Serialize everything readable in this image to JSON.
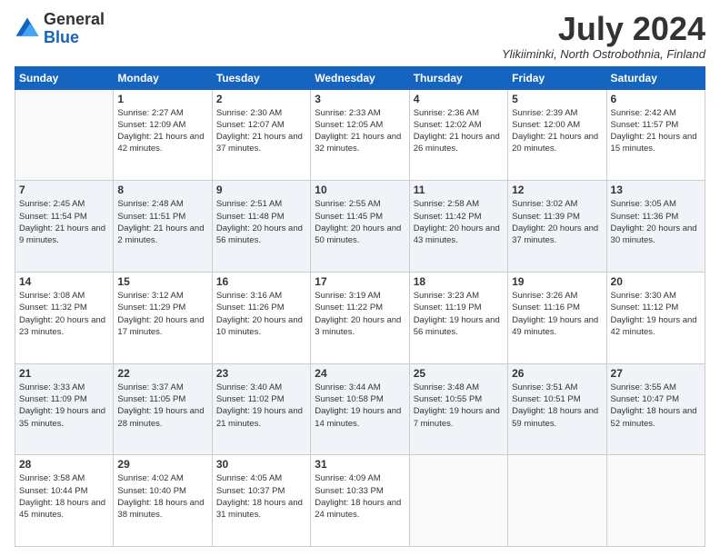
{
  "logo": {
    "general": "General",
    "blue": "Blue"
  },
  "title": "July 2024",
  "location": "Ylikiiminki, North Ostrobothnia, Finland",
  "days_of_week": [
    "Sunday",
    "Monday",
    "Tuesday",
    "Wednesday",
    "Thursday",
    "Friday",
    "Saturday"
  ],
  "weeks": [
    [
      {
        "day": "",
        "empty": true
      },
      {
        "day": "1",
        "sunrise": "Sunrise: 2:27 AM",
        "sunset": "Sunset: 12:09 AM",
        "daylight": "Daylight: 21 hours and 42 minutes."
      },
      {
        "day": "2",
        "sunrise": "Sunrise: 2:30 AM",
        "sunset": "Sunset: 12:07 AM",
        "daylight": "Daylight: 21 hours and 37 minutes."
      },
      {
        "day": "3",
        "sunrise": "Sunrise: 2:33 AM",
        "sunset": "Sunset: 12:05 AM",
        "daylight": "Daylight: 21 hours and 32 minutes."
      },
      {
        "day": "4",
        "sunrise": "Sunrise: 2:36 AM",
        "sunset": "Sunset: 12:02 AM",
        "daylight": "Daylight: 21 hours and 26 minutes."
      },
      {
        "day": "5",
        "sunrise": "Sunrise: 2:39 AM",
        "sunset": "Sunset: 12:00 AM",
        "daylight": "Daylight: 21 hours and 20 minutes."
      },
      {
        "day": "6",
        "sunrise": "Sunrise: 2:42 AM",
        "sunset": "Sunset: 11:57 PM",
        "daylight": "Daylight: 21 hours and 15 minutes."
      }
    ],
    [
      {
        "day": "7",
        "sunrise": "Sunrise: 2:45 AM",
        "sunset": "Sunset: 11:54 PM",
        "daylight": "Daylight: 21 hours and 9 minutes."
      },
      {
        "day": "8",
        "sunrise": "Sunrise: 2:48 AM",
        "sunset": "Sunset: 11:51 PM",
        "daylight": "Daylight: 21 hours and 2 minutes."
      },
      {
        "day": "9",
        "sunrise": "Sunrise: 2:51 AM",
        "sunset": "Sunset: 11:48 PM",
        "daylight": "Daylight: 20 hours and 56 minutes."
      },
      {
        "day": "10",
        "sunrise": "Sunrise: 2:55 AM",
        "sunset": "Sunset: 11:45 PM",
        "daylight": "Daylight: 20 hours and 50 minutes."
      },
      {
        "day": "11",
        "sunrise": "Sunrise: 2:58 AM",
        "sunset": "Sunset: 11:42 PM",
        "daylight": "Daylight: 20 hours and 43 minutes."
      },
      {
        "day": "12",
        "sunrise": "Sunrise: 3:02 AM",
        "sunset": "Sunset: 11:39 PM",
        "daylight": "Daylight: 20 hours and 37 minutes."
      },
      {
        "day": "13",
        "sunrise": "Sunrise: 3:05 AM",
        "sunset": "Sunset: 11:36 PM",
        "daylight": "Daylight: 20 hours and 30 minutes."
      }
    ],
    [
      {
        "day": "14",
        "sunrise": "Sunrise: 3:08 AM",
        "sunset": "Sunset: 11:32 PM",
        "daylight": "Daylight: 20 hours and 23 minutes."
      },
      {
        "day": "15",
        "sunrise": "Sunrise: 3:12 AM",
        "sunset": "Sunset: 11:29 PM",
        "daylight": "Daylight: 20 hours and 17 minutes."
      },
      {
        "day": "16",
        "sunrise": "Sunrise: 3:16 AM",
        "sunset": "Sunset: 11:26 PM",
        "daylight": "Daylight: 20 hours and 10 minutes."
      },
      {
        "day": "17",
        "sunrise": "Sunrise: 3:19 AM",
        "sunset": "Sunset: 11:22 PM",
        "daylight": "Daylight: 20 hours and 3 minutes."
      },
      {
        "day": "18",
        "sunrise": "Sunrise: 3:23 AM",
        "sunset": "Sunset: 11:19 PM",
        "daylight": "Daylight: 19 hours and 56 minutes."
      },
      {
        "day": "19",
        "sunrise": "Sunrise: 3:26 AM",
        "sunset": "Sunset: 11:16 PM",
        "daylight": "Daylight: 19 hours and 49 minutes."
      },
      {
        "day": "20",
        "sunrise": "Sunrise: 3:30 AM",
        "sunset": "Sunset: 11:12 PM",
        "daylight": "Daylight: 19 hours and 42 minutes."
      }
    ],
    [
      {
        "day": "21",
        "sunrise": "Sunrise: 3:33 AM",
        "sunset": "Sunset: 11:09 PM",
        "daylight": "Daylight: 19 hours and 35 minutes."
      },
      {
        "day": "22",
        "sunrise": "Sunrise: 3:37 AM",
        "sunset": "Sunset: 11:05 PM",
        "daylight": "Daylight: 19 hours and 28 minutes."
      },
      {
        "day": "23",
        "sunrise": "Sunrise: 3:40 AM",
        "sunset": "Sunset: 11:02 PM",
        "daylight": "Daylight: 19 hours and 21 minutes."
      },
      {
        "day": "24",
        "sunrise": "Sunrise: 3:44 AM",
        "sunset": "Sunset: 10:58 PM",
        "daylight": "Daylight: 19 hours and 14 minutes."
      },
      {
        "day": "25",
        "sunrise": "Sunrise: 3:48 AM",
        "sunset": "Sunset: 10:55 PM",
        "daylight": "Daylight: 19 hours and 7 minutes."
      },
      {
        "day": "26",
        "sunrise": "Sunrise: 3:51 AM",
        "sunset": "Sunset: 10:51 PM",
        "daylight": "Daylight: 18 hours and 59 minutes."
      },
      {
        "day": "27",
        "sunrise": "Sunrise: 3:55 AM",
        "sunset": "Sunset: 10:47 PM",
        "daylight": "Daylight: 18 hours and 52 minutes."
      }
    ],
    [
      {
        "day": "28",
        "sunrise": "Sunrise: 3:58 AM",
        "sunset": "Sunset: 10:44 PM",
        "daylight": "Daylight: 18 hours and 45 minutes."
      },
      {
        "day": "29",
        "sunrise": "Sunrise: 4:02 AM",
        "sunset": "Sunset: 10:40 PM",
        "daylight": "Daylight: 18 hours and 38 minutes."
      },
      {
        "day": "30",
        "sunrise": "Sunrise: 4:05 AM",
        "sunset": "Sunset: 10:37 PM",
        "daylight": "Daylight: 18 hours and 31 minutes."
      },
      {
        "day": "31",
        "sunrise": "Sunrise: 4:09 AM",
        "sunset": "Sunset: 10:33 PM",
        "daylight": "Daylight: 18 hours and 24 minutes."
      },
      {
        "day": "",
        "empty": true
      },
      {
        "day": "",
        "empty": true
      },
      {
        "day": "",
        "empty": true
      }
    ]
  ]
}
